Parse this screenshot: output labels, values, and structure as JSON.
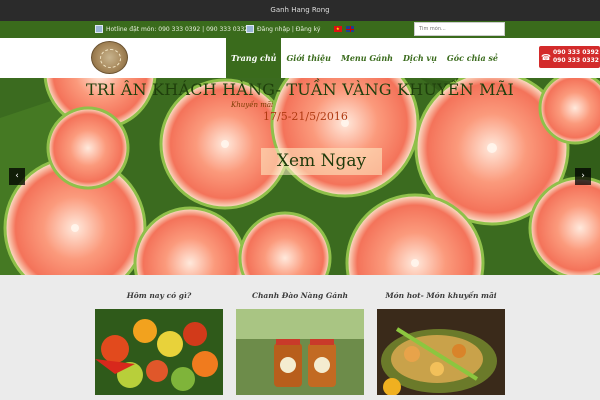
{
  "window": {
    "title": "Ganh Hang Rong"
  },
  "topbar": {
    "hotline": "Hotline đặt món: 090 333 0392 | 090 333 0332",
    "login": "Đăng nhập | Đăng ký",
    "search_placeholder": "Tìm món..."
  },
  "nav": {
    "items": [
      {
        "label": "Trang chủ"
      },
      {
        "label": "Giới thiệu"
      },
      {
        "label": "Menu Gánh"
      },
      {
        "label": "Dịch vụ"
      },
      {
        "label": "Góc chia sẻ"
      }
    ],
    "phone_1": "090 333 0392",
    "phone_2": "090 333 0332"
  },
  "banner": {
    "title": "TRI ÂN KHÁCH HÀNG- TUẦN VÀNG KHUYẾN MÃI",
    "subtitle": "Khuyến mãi",
    "date": "17/5-21/5/2016",
    "cta": "Xem Ngay"
  },
  "sections": [
    {
      "title": "Hôm nay có gì?"
    },
    {
      "title": "Chanh Đào Nàng Gánh"
    },
    {
      "title": "Món hot- Món khuyến mãi"
    }
  ],
  "colors": {
    "brand_green": "#3a6b1c",
    "phone_red": "#d32b2b"
  }
}
